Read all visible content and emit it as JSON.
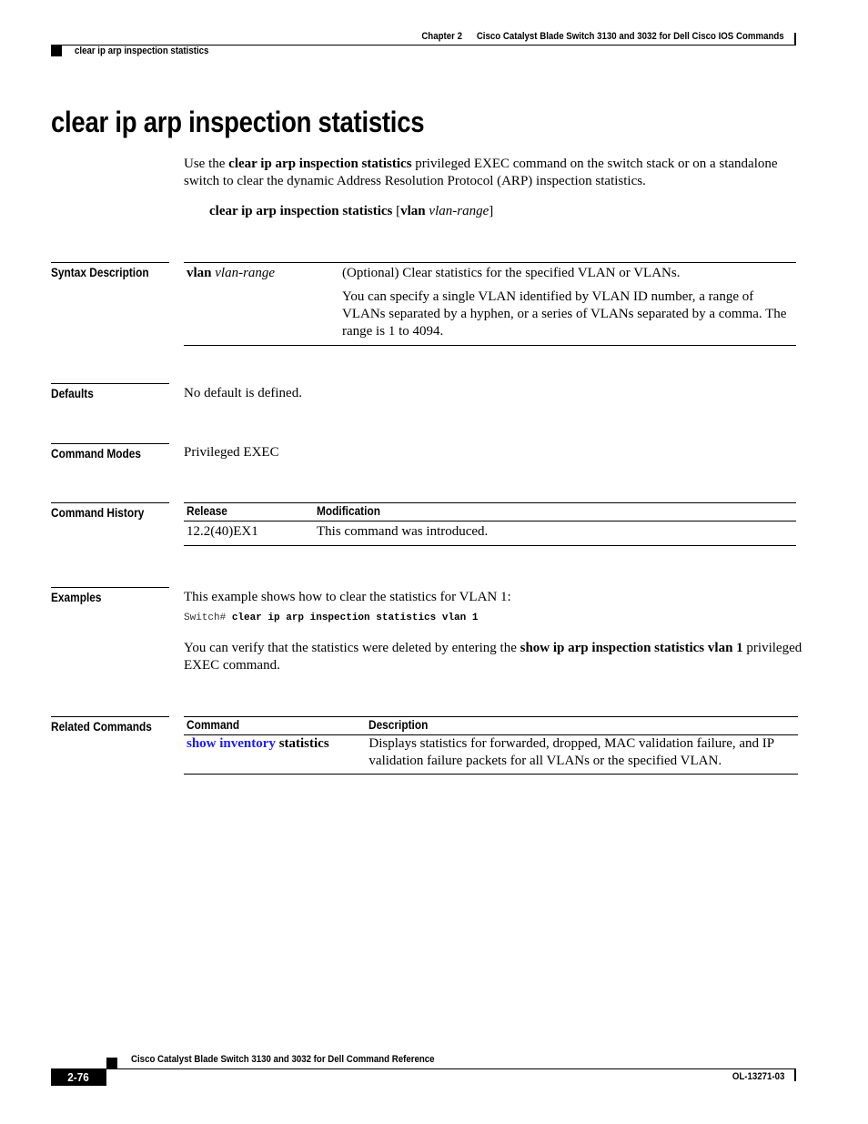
{
  "header": {
    "chapter": "Chapter 2",
    "chapter_title": "Cisco Catalyst Blade Switch 3130 and 3032 for Dell Cisco IOS Commands",
    "section": "clear ip arp inspection statistics"
  },
  "title": "clear ip arp inspection statistics",
  "intro": {
    "pre": "Use the ",
    "command": "clear ip arp inspection statistics",
    "post": " privileged EXEC command on the switch stack or on a standalone switch to clear the dynamic Address Resolution Protocol (ARP) inspection statistics."
  },
  "syntax_line": {
    "command": "clear ip arp inspection statistics",
    "open_bracket": " [",
    "keyword": "vlan",
    "argument": "vlan-range",
    "close_bracket": "]"
  },
  "syntax_description": {
    "label": "Syntax Description",
    "rows": [
      {
        "keyword": "vlan",
        "argument": "vlan-range",
        "description": [
          "(Optional) Clear statistics for the specified VLAN or VLANs.",
          "You can specify a single VLAN identified by VLAN ID number, a range of VLANs separated by a hyphen, or a series of VLANs separated by a comma. The range is 1 to 4094."
        ]
      }
    ]
  },
  "defaults": {
    "label": "Defaults",
    "text": "No default is defined."
  },
  "command_modes": {
    "label": "Command Modes",
    "text": "Privileged EXEC"
  },
  "command_history": {
    "label": "Command History",
    "columns": [
      "Release",
      "Modification"
    ],
    "rows": [
      {
        "release": "12.2(40)EX1",
        "modification": "This command was introduced."
      }
    ]
  },
  "examples": {
    "label": "Examples",
    "intro": "This example shows how to clear the statistics for VLAN 1:",
    "code_prompt": "Switch# ",
    "code_command": "clear ip arp inspection statistics vlan 1",
    "verify_pre": "You can verify that the statistics were deleted by entering the ",
    "verify_command": "show ip arp inspection statistics vlan 1",
    "verify_post": " privileged EXEC command."
  },
  "related_commands": {
    "label": "Related Commands",
    "columns": [
      "Command",
      "Description"
    ],
    "rows": [
      {
        "command_link": "show inventory",
        "command_rest": " statistics",
        "description": "Displays statistics for forwarded, dropped, MAC validation failure, and IP validation failure packets for all VLANs or the specified VLAN."
      }
    ]
  },
  "footer": {
    "title": "Cisco Catalyst Blade Switch 3130 and 3032 for Dell Command Reference",
    "page": "2-76",
    "doc_number": "OL-13271-03"
  },
  "colors": {
    "link": "#1a1aff",
    "text": "#000000"
  }
}
